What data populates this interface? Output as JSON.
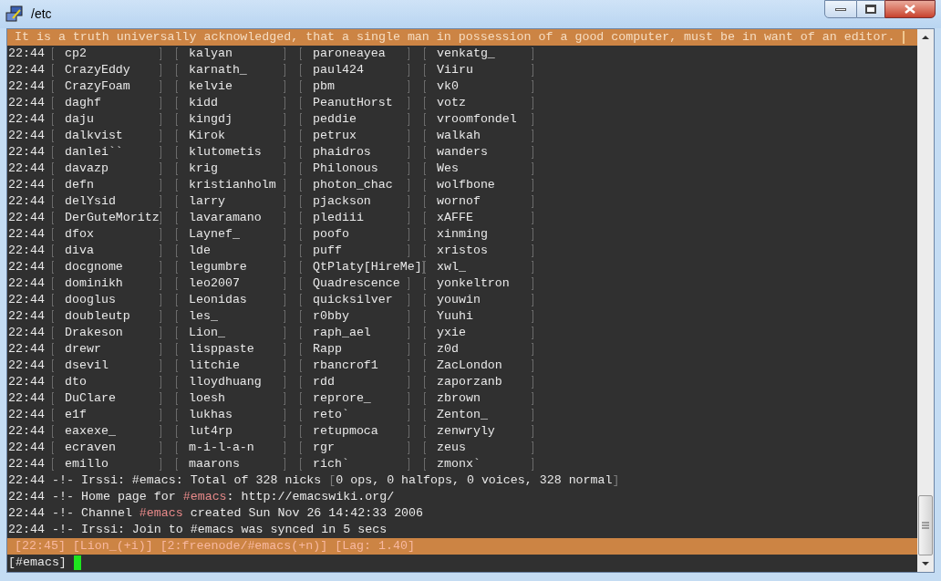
{
  "window": {
    "title": "/etc"
  },
  "topic": "It is a truth universally acknowledged, that a single man in possession of a good computer, must be in want of an editor.",
  "nick_rows": [
    {
      "time": "22:44",
      "nicks": [
        "cp2",
        "kalyan",
        "paroneayea",
        "venkatg_"
      ]
    },
    {
      "time": "22:44",
      "nicks": [
        "CrazyEddy",
        "karnath_",
        "paul424",
        "Viiru"
      ]
    },
    {
      "time": "22:44",
      "nicks": [
        "CrazyFoam",
        "kelvie",
        "pbm",
        "vk0"
      ]
    },
    {
      "time": "22:44",
      "nicks": [
        "daghf",
        "kidd",
        "PeanutHorst",
        "votz"
      ]
    },
    {
      "time": "22:44",
      "nicks": [
        "daju",
        "kingdj",
        "peddie",
        "vroomfondel"
      ]
    },
    {
      "time": "22:44",
      "nicks": [
        "dalkvist",
        "Kirok",
        "petrux",
        "walkah"
      ]
    },
    {
      "time": "22:44",
      "nicks": [
        "danlei``",
        "klutometis",
        "phaidros",
        "wanders"
      ]
    },
    {
      "time": "22:44",
      "nicks": [
        "davazp",
        "krig",
        "Philonous",
        "Wes"
      ]
    },
    {
      "time": "22:44",
      "nicks": [
        "defn",
        "kristianholm",
        "photon_chac",
        "wolfbone"
      ]
    },
    {
      "time": "22:44",
      "nicks": [
        "delYsid",
        "larry",
        "pjackson",
        "wornof"
      ]
    },
    {
      "time": "22:44",
      "nicks": [
        "DerGuteMoritz",
        "lavaramano",
        "plediii",
        "xAFFE"
      ]
    },
    {
      "time": "22:44",
      "nicks": [
        "dfox",
        "Laynef_",
        "poofo",
        "xinming"
      ]
    },
    {
      "time": "22:44",
      "nicks": [
        "diva",
        "lde",
        "puff",
        "xristos"
      ]
    },
    {
      "time": "22:44",
      "nicks": [
        "docgnome",
        "legumbre",
        "QtPlaty[HireMe]",
        "xwl_"
      ]
    },
    {
      "time": "22:44",
      "nicks": [
        "dominikh",
        "leo2007",
        "Quadrescence",
        "yonkeltron"
      ]
    },
    {
      "time": "22:44",
      "nicks": [
        "dooglus",
        "Leonidas",
        "quicksilver",
        "youwin"
      ]
    },
    {
      "time": "22:44",
      "nicks": [
        "doubleutp",
        "les_",
        "r0bby",
        "Yuuhi"
      ]
    },
    {
      "time": "22:44",
      "nicks": [
        "Drakeson",
        "Lion_",
        "raph_ael",
        "yxie"
      ]
    },
    {
      "time": "22:44",
      "nicks": [
        "drewr",
        "lisppaste",
        "Rapp",
        "z0d"
      ]
    },
    {
      "time": "22:44",
      "nicks": [
        "dsevil",
        "litchie",
        "rbancrof1",
        "ZacLondon"
      ]
    },
    {
      "time": "22:44",
      "nicks": [
        "dto",
        "lloydhuang",
        "rdd",
        "zaporzanb"
      ]
    },
    {
      "time": "22:44",
      "nicks": [
        "DuClare",
        "loesh",
        "reprore_",
        "zbrown"
      ]
    },
    {
      "time": "22:44",
      "nicks": [
        "e1f",
        "lukhas",
        "reto`",
        "Zenton_"
      ]
    },
    {
      "time": "22:44",
      "nicks": [
        "eaxexe_",
        "lut4rp",
        "retupmoca",
        "zenwryly"
      ]
    },
    {
      "time": "22:44",
      "nicks": [
        "ecraven",
        "m-i-l-a-n",
        "rgr",
        "zeus"
      ]
    },
    {
      "time": "22:44",
      "nicks": [
        "emillo",
        "maarons",
        "rich`",
        "zmonx`"
      ]
    }
  ],
  "log_lines": [
    {
      "time": "22:44",
      "prefix": "-!-",
      "segments": [
        {
          "kind": "plain",
          "text": "Irssi: #emacs: Total of 328 nicks "
        },
        {
          "kind": "dim",
          "text": "["
        },
        {
          "kind": "plain",
          "text": "0 ops, 0 halfops, 0 voices, 328 normal"
        },
        {
          "kind": "dim",
          "text": "]"
        }
      ]
    },
    {
      "time": "22:44",
      "prefix": "-!-",
      "segments": [
        {
          "kind": "plain",
          "text": "Home page for "
        },
        {
          "kind": "channel",
          "text": "#emacs"
        },
        {
          "kind": "plain",
          "text": ": http://emacswiki.org/"
        }
      ]
    },
    {
      "time": "22:44",
      "prefix": "-!-",
      "segments": [
        {
          "kind": "plain",
          "text": "Channel "
        },
        {
          "kind": "channel",
          "text": "#emacs"
        },
        {
          "kind": "plain",
          "text": " created Sun Nov 26 14:42:33 2006"
        }
      ]
    },
    {
      "time": "22:44",
      "prefix": "-!-",
      "segments": [
        {
          "kind": "plain",
          "text": "Irssi: Join to #emacs was synced in 5 secs"
        }
      ]
    }
  ],
  "status_bar": [
    "[22:45]",
    "[Lion_(+i)]",
    "[2:freenode/#emacs(+n)]",
    "[Lag: 1.40]"
  ],
  "prompt": "[#emacs]"
}
